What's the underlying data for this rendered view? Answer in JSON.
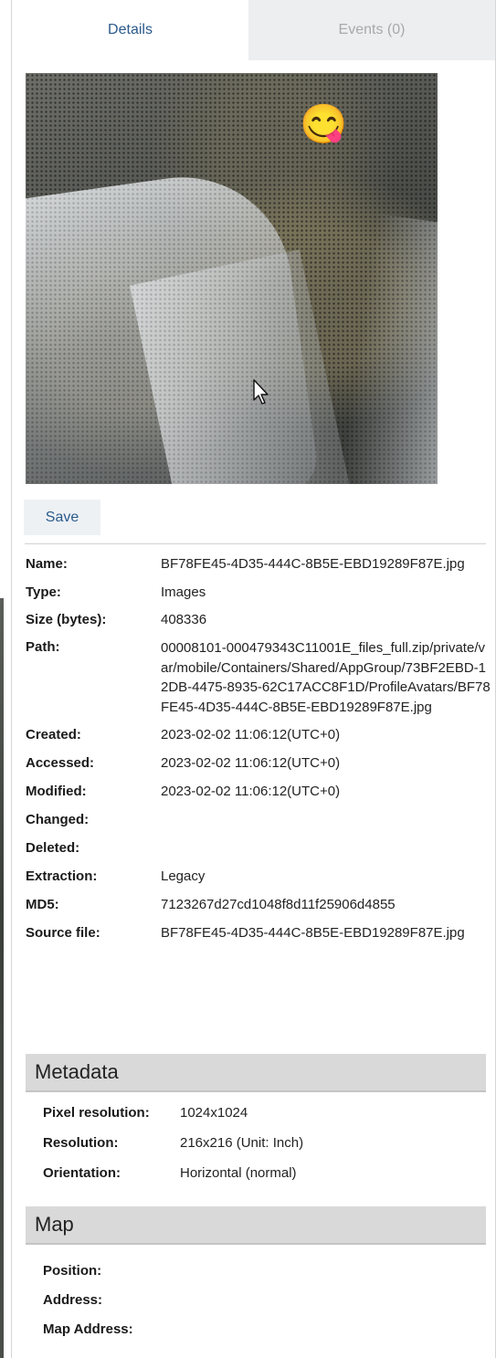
{
  "tabs": [
    {
      "label": "Details",
      "active": true
    },
    {
      "label": "Events (0)",
      "active": false
    }
  ],
  "preview": {
    "emoji": "😋"
  },
  "actions": {
    "save_label": "Save"
  },
  "properties": [
    {
      "label": "Name:",
      "value": "BF78FE45-4D35-444C-8B5E-EBD19289F87E.jpg"
    },
    {
      "label": "Type:",
      "value": "Images"
    },
    {
      "label": "Size (bytes):",
      "value": "408336"
    },
    {
      "label": "Path:",
      "value": "00008101-000479343C11001E_files_full.zip/private/var/mobile/Containers/Shared/AppGroup/73BF2EBD-12DB-4475-8935-62C17ACC8F1D/ProfileAvatars/BF78FE45-4D35-444C-8B5E-EBD19289F87E.jpg"
    },
    {
      "label": "Created:",
      "value": "2023-02-02 11:06:12(UTC+0)"
    },
    {
      "label": "Accessed:",
      "value": "2023-02-02 11:06:12(UTC+0)"
    },
    {
      "label": "Modified:",
      "value": "2023-02-02 11:06:12(UTC+0)"
    },
    {
      "label": "Changed:",
      "value": ""
    },
    {
      "label": "Deleted:",
      "value": ""
    },
    {
      "label": "Extraction:",
      "value": "Legacy"
    },
    {
      "label": "MD5:",
      "value": "7123267d27cd1048f8d11f25906d4855"
    },
    {
      "label": "Source file:",
      "value": "BF78FE45-4D35-444C-8B5E-EBD19289F87E.jpg"
    }
  ],
  "metadata": {
    "title": "Metadata",
    "rows": [
      {
        "label": "Pixel resolution:",
        "value": "1024x1024"
      },
      {
        "label": "Resolution:",
        "value": "216x216 (Unit: Inch)"
      },
      {
        "label": "Orientation:",
        "value": "Horizontal (normal)"
      }
    ]
  },
  "map": {
    "title": "Map",
    "rows": [
      {
        "label": "Position:",
        "value": ""
      },
      {
        "label": "Address:",
        "value": ""
      },
      {
        "label": "Map Address:",
        "value": ""
      }
    ]
  },
  "colors": {
    "accent": "#2b5a8c",
    "tab_inactive_bg": "#eceef0",
    "section_bg": "#d9d9d9"
  }
}
